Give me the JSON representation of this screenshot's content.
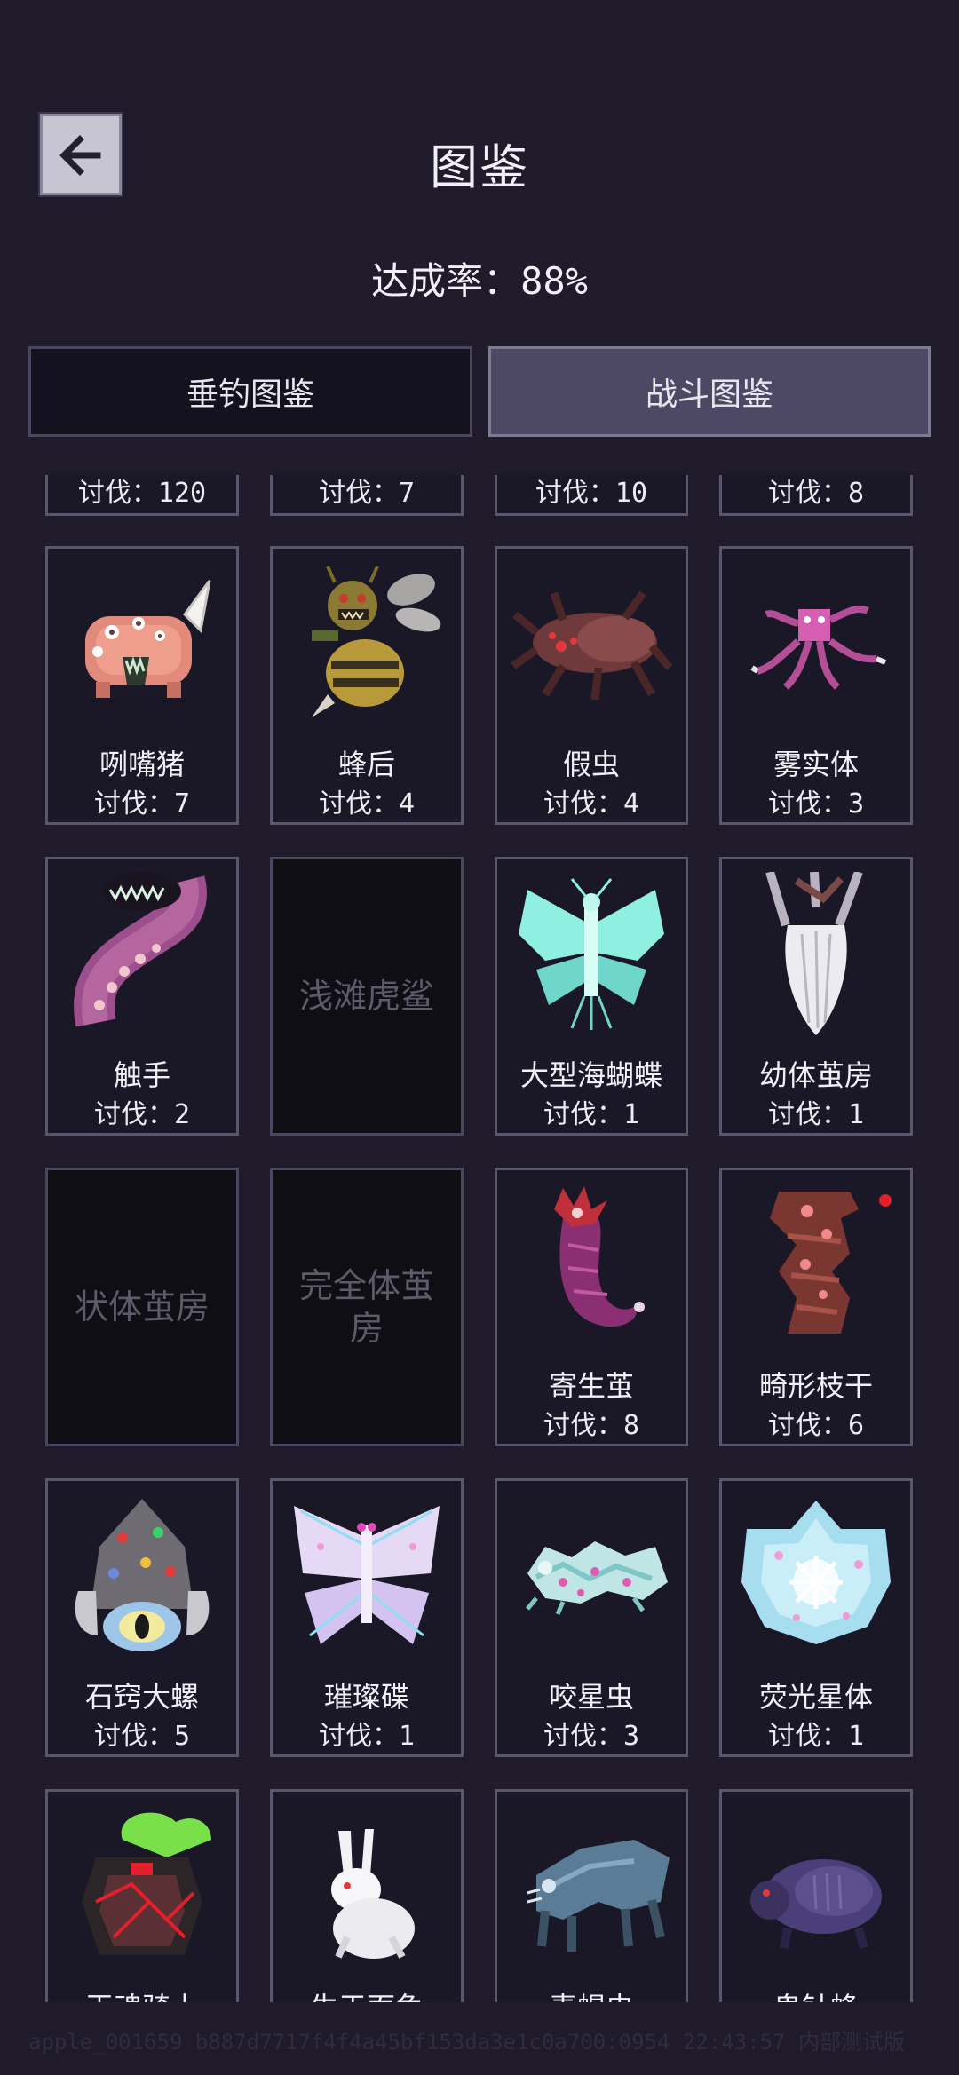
{
  "header": {
    "title": "图鉴",
    "completion_label": "达成率：",
    "completion_value": "88%"
  },
  "tabs": [
    {
      "label": "垂钓图鉴",
      "active": false
    },
    {
      "label": "战斗图鉴",
      "active": true
    }
  ],
  "partial_row": [
    "讨伐：120",
    "讨伐：7",
    "讨伐：10",
    "讨伐：8"
  ],
  "cards": [
    {
      "name": "咧嘴猪",
      "kills": "讨伐：7",
      "icon": "grin-pig-icon",
      "unlocked": true
    },
    {
      "name": "蜂后",
      "kills": "讨伐：4",
      "icon": "queen-bee-icon",
      "unlocked": true
    },
    {
      "name": "假虫",
      "kills": "讨伐：4",
      "icon": "fake-bug-icon",
      "unlocked": true
    },
    {
      "name": "雾实体",
      "kills": "讨伐：3",
      "icon": "mist-entity-icon",
      "unlocked": true
    },
    {
      "name": "触手",
      "kills": "讨伐：2",
      "icon": "tentacle-icon",
      "unlocked": true
    },
    {
      "name": "浅滩虎鲨",
      "kills": "",
      "icon": "",
      "unlocked": false
    },
    {
      "name": "大型海蝴蝶",
      "kills": "讨伐：1",
      "icon": "sea-butterfly-icon",
      "unlocked": true
    },
    {
      "name": "幼体茧房",
      "kills": "讨伐：1",
      "icon": "larva-cocoon-icon",
      "unlocked": true
    },
    {
      "name": "状体茧房",
      "kills": "",
      "icon": "",
      "unlocked": false
    },
    {
      "name": "完全体茧房",
      "kills": "",
      "icon": "",
      "unlocked": false
    },
    {
      "name": "寄生茧",
      "kills": "讨伐：8",
      "icon": "parasite-cocoon-icon",
      "unlocked": true
    },
    {
      "name": "畸形枝干",
      "kills": "讨伐：6",
      "icon": "deformed-branch-icon",
      "unlocked": true
    },
    {
      "name": "石窍大螺",
      "kills": "讨伐：5",
      "icon": "stone-snail-icon",
      "unlocked": true
    },
    {
      "name": "璀璨碟",
      "kills": "讨伐：1",
      "icon": "brilliant-moth-icon",
      "unlocked": true
    },
    {
      "name": "咬星虫",
      "kills": "讨伐：3",
      "icon": "star-biter-icon",
      "unlocked": true
    },
    {
      "name": "荧光星体",
      "kills": "讨伐：1",
      "icon": "glow-star-icon",
      "unlocked": true
    },
    {
      "name": "王魂骑士",
      "kills": "",
      "icon": "soul-knight-icon",
      "unlocked": true
    },
    {
      "name": "生于面兔",
      "kills": "",
      "icon": "white-rabbit-icon",
      "unlocked": true
    },
    {
      "name": "毒蝎虫",
      "kills": "",
      "icon": "blue-beast-icon",
      "unlocked": true
    },
    {
      "name": "鬼针蜂",
      "kills": "",
      "icon": "purple-boar-icon",
      "unlocked": true
    }
  ],
  "watermark": "apple_001659 b887d7717f4f4a45bf153da3e1c0a700:0954 22:43:57 内部测试版"
}
